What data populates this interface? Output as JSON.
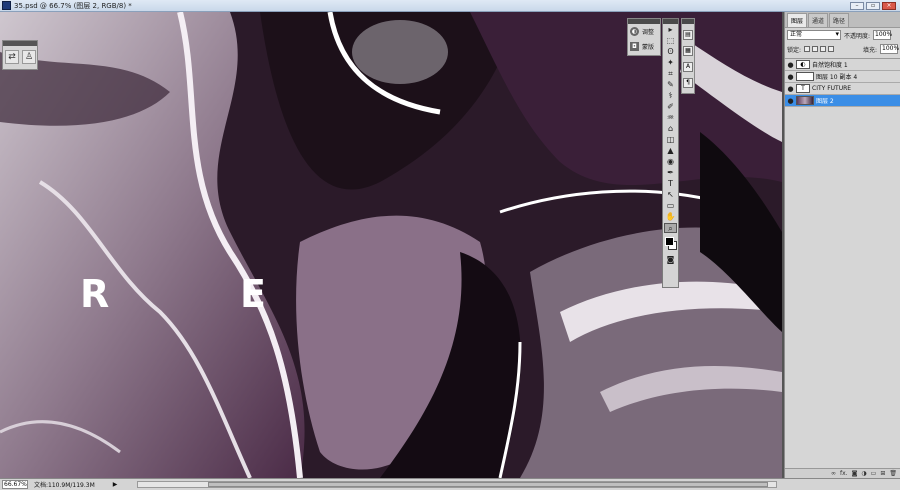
{
  "window": {
    "title": "35.psd @ 66.7% (图层 2, RGB/8) *",
    "controls": {
      "minimize": "–",
      "maximize": "▫",
      "close": "×"
    }
  },
  "canvas": {
    "letters": [
      "R",
      "E"
    ],
    "palette": {
      "dark": "#1f1420",
      "purple": "#5a2a55",
      "light": "#d8d0d8",
      "white": "#ffffff"
    }
  },
  "mini_panel": {
    "icons": [
      "brush-settings-icon",
      "clone-source-icon"
    ]
  },
  "adjustments_panel": {
    "items": [
      {
        "label": "调整",
        "icon": "adjustment-icon"
      },
      {
        "label": "蒙版",
        "icon": "mask-icon"
      }
    ]
  },
  "toolbar": {
    "tools": [
      "▸",
      "⬚",
      "ʘ",
      "✦",
      "⌗",
      "✎",
      "⚕",
      "✐",
      "♒",
      "⌂",
      "◫",
      "▲",
      "◉",
      "✒",
      "T",
      "↖",
      "▭",
      "✋",
      "⌕"
    ],
    "selected_index": 18
  },
  "layers": {
    "tabs": [
      "图层",
      "通道",
      "路径"
    ],
    "active_tab": 0,
    "blend_mode": "正常",
    "opacity_label": "不透明度:",
    "opacity_value": "100%",
    "lock_label": "锁定:",
    "fill_label": "填充:",
    "fill_value": "100%",
    "items": [
      {
        "name": "自然饱和度 1",
        "thumb": "◐",
        "selected": false
      },
      {
        "name": "图层 10 副本 4",
        "thumb": "",
        "selected": false
      },
      {
        "name": "CITY FUTURE",
        "thumb": "T",
        "selected": false
      },
      {
        "name": "图层 2",
        "thumb": "",
        "selected": true
      }
    ],
    "footer_icons": [
      "∞",
      "fx.",
      "◙",
      "◑",
      "▭",
      "⊞",
      "🗑"
    ]
  },
  "status": {
    "zoom": "66.67%",
    "doc_info": "文档:110.9M/119.3M",
    "arrow": "▶"
  }
}
